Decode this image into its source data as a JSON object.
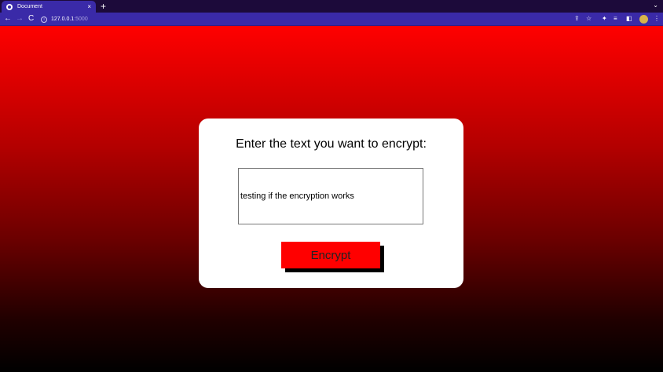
{
  "browser": {
    "tab_title": "Document",
    "tab_close": "×",
    "new_tab": "+",
    "tabs_menu": "⌄",
    "nav": {
      "back": "←",
      "forward": "→",
      "reload": "C"
    },
    "url_host": "127.0.0.1",
    "url_port": ":5000",
    "toolbar_icons": [
      "share-icon",
      "star-icon",
      "extensions-icon",
      "reading-list-icon",
      "side-panel-icon",
      "profile-avatar",
      "menu-icon"
    ]
  },
  "page": {
    "prompt": "Enter the text you want to encrypt:",
    "input_value": "testing if the encryption works",
    "button_label": "Encrypt",
    "colors": {
      "gradient_top": "#ff0000",
      "gradient_bottom": "#000000",
      "button": "#ff0000",
      "card": "#ffffff"
    }
  }
}
